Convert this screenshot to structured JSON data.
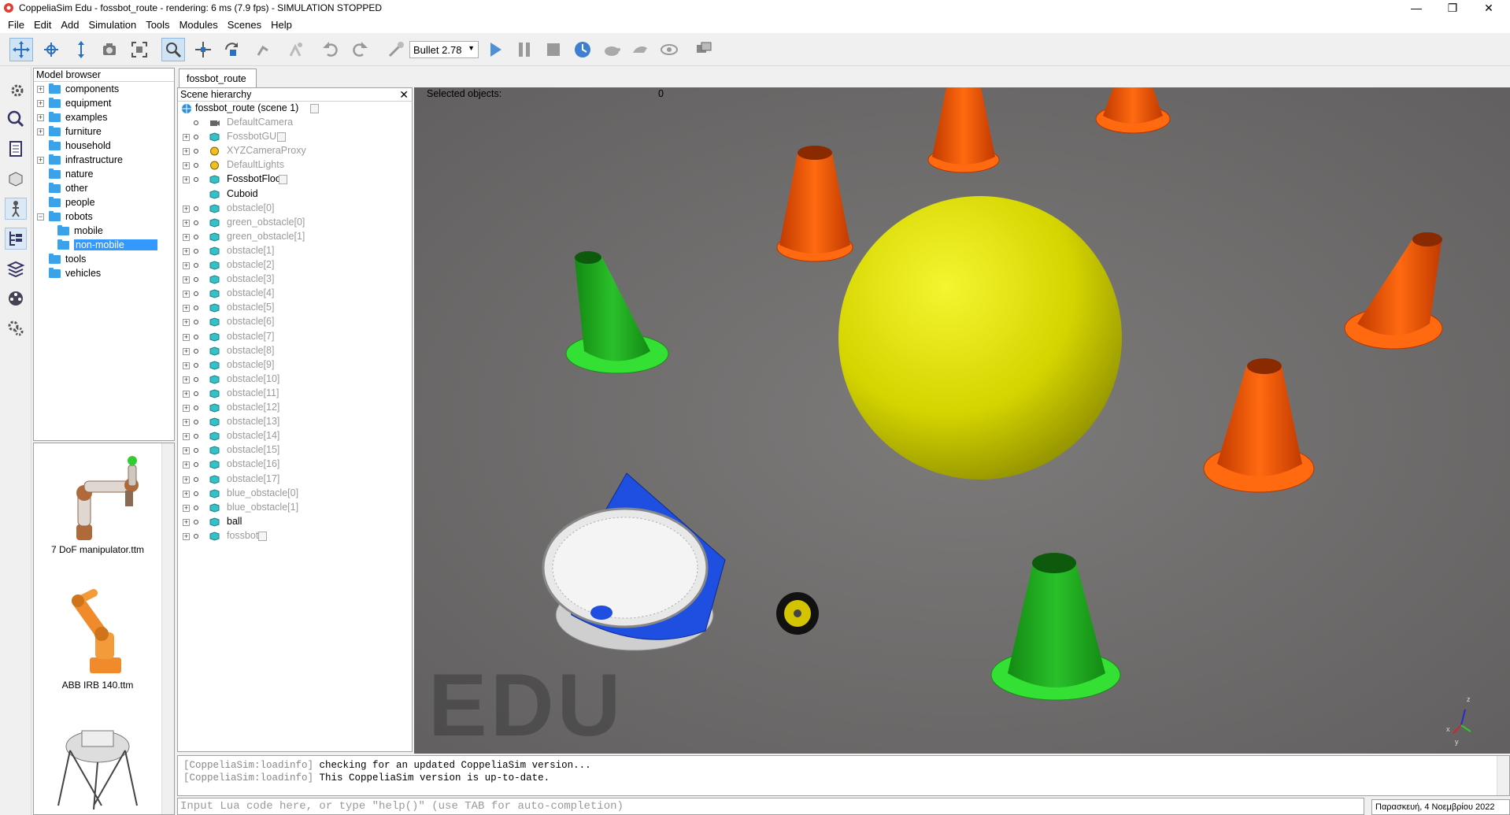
{
  "window": {
    "title": "CoppeliaSim Edu - fossbot_route - rendering: 6 ms (7.9 fps) - SIMULATION STOPPED"
  },
  "menu": [
    "File",
    "Edit",
    "Add",
    "Simulation",
    "Tools",
    "Modules",
    "Scenes",
    "Help"
  ],
  "toolbar": {
    "physics_engine": "Bullet 2.78",
    "icons": [
      "camera-pan-icon",
      "camera-rotate-icon",
      "camera-shift-icon",
      "camera-angle-icon",
      "fit-to-view-icon",
      "click-select-icon",
      "object-shift-icon",
      "object-rotate-icon",
      "assemble-icon",
      "transfer-dna-icon",
      "undo-icon",
      "redo-icon",
      "dynamics-content-icon",
      "play-icon",
      "pause-icon",
      "stop-icon",
      "real-time-icon",
      "slow-down-icon",
      "speed-up-icon",
      "visualization-icon",
      "scene-view-icon"
    ]
  },
  "model_browser": {
    "header": "Model browser",
    "items": [
      {
        "label": "components",
        "expander": "+"
      },
      {
        "label": "equipment",
        "expander": "+"
      },
      {
        "label": "examples",
        "expander": "+"
      },
      {
        "label": "furniture",
        "expander": "+"
      },
      {
        "label": "household",
        "expander": ""
      },
      {
        "label": "infrastructure",
        "expander": "+"
      },
      {
        "label": "nature",
        "expander": ""
      },
      {
        "label": "other",
        "expander": ""
      },
      {
        "label": "people",
        "expander": ""
      },
      {
        "label": "robots",
        "expander": "−"
      },
      {
        "label": "mobile",
        "expander": ""
      },
      {
        "label": "non-mobile",
        "expander": ""
      },
      {
        "label": "tools",
        "expander": ""
      },
      {
        "label": "vehicles",
        "expander": ""
      }
    ]
  },
  "thumbnails": [
    {
      "label": "7 DoF manipulator.ttm"
    },
    {
      "label": "ABB IRB 140.ttm"
    }
  ],
  "scene_tab": "fossbot_route",
  "scene_hierarchy": {
    "header": "Scene hierarchy",
    "root": "fossbot_route (scene 1)",
    "items": [
      "DefaultCamera",
      "FossbotGUI",
      "XYZCameraProxy",
      "DefaultLights",
      "FossbotFloor",
      "Cuboid",
      "obstacle[0]",
      "green_obstacle[0]",
      "green_obstacle[1]",
      "obstacle[1]",
      "obstacle[2]",
      "obstacle[3]",
      "obstacle[4]",
      "obstacle[5]",
      "obstacle[6]",
      "obstacle[7]",
      "obstacle[8]",
      "obstacle[9]",
      "obstacle[10]",
      "obstacle[11]",
      "obstacle[12]",
      "obstacle[13]",
      "obstacle[14]",
      "obstacle[15]",
      "obstacle[16]",
      "obstacle[17]",
      "blue_obstacle[0]",
      "blue_obstacle[1]",
      "ball",
      "fossbot"
    ]
  },
  "viewport": {
    "selected_label": "Selected objects:",
    "selected_count": "0",
    "watermark": "EDU",
    "axis_labels": [
      "z",
      "x",
      "y"
    ]
  },
  "console": {
    "lines": [
      {
        "tag": "[CoppeliaSim:loadinfo]",
        "msg": " checking for an updated CoppeliaSim version..."
      },
      {
        "tag": "[CoppeliaSim:loadinfo]",
        "msg": " This CoppeliaSim version is up-to-date."
      }
    ],
    "input_placeholder": "Input Lua code here, or type \"help()\" (use TAB for auto-completion)"
  },
  "status": {
    "date": "Παρασκευή, 4 Νοεμβρίου 2022"
  },
  "colors": {
    "selection": "#3399ff",
    "folder": "#3aa2e8",
    "cone_orange": "#ff5a00",
    "cone_green": "#1fb81f",
    "ball_yellow": "#dede00",
    "robot_blue": "#1f4fe0"
  }
}
